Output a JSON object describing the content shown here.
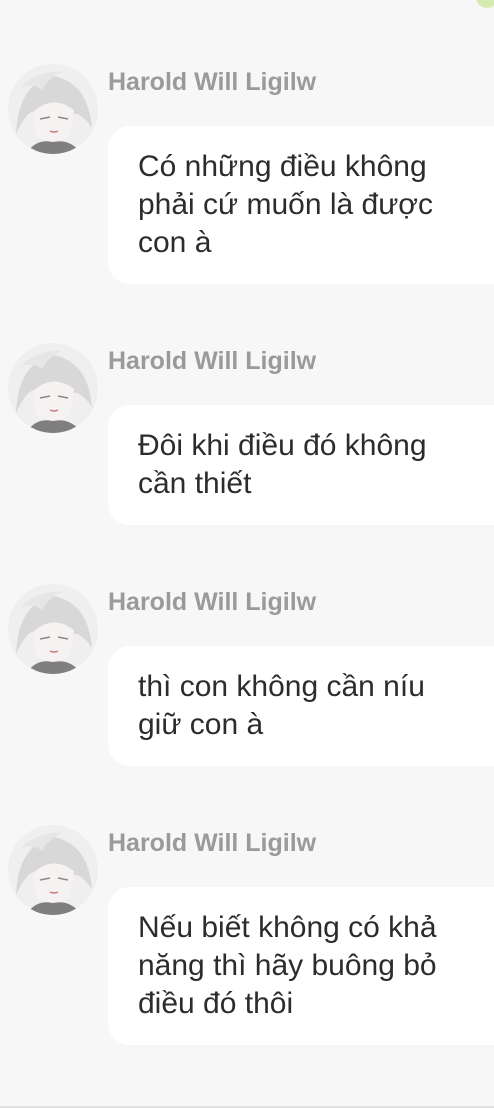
{
  "messages": [
    {
      "sender": "Harold Will Ligilw",
      "text": "Có những điều không\nphải cứ muốn là được\ncon à"
    },
    {
      "sender": "Harold Will Ligilw",
      "text": "Đôi khi điều đó không\ncần thiết"
    },
    {
      "sender": "Harold Will Ligilw",
      "text": "thì con không cần níu\ngiữ con à"
    },
    {
      "sender": "Harold Will Ligilw",
      "text": "Nếu biết không có khả\nnăng thì hãy buông bỏ\nđiều đó thôi"
    }
  ],
  "avatar_icon": "anime-avatar-icon",
  "colors": {
    "background": "#f7f7f7",
    "bubble": "#ffffff",
    "sender": "#9a9a9a",
    "text": "#2c2c2c"
  }
}
